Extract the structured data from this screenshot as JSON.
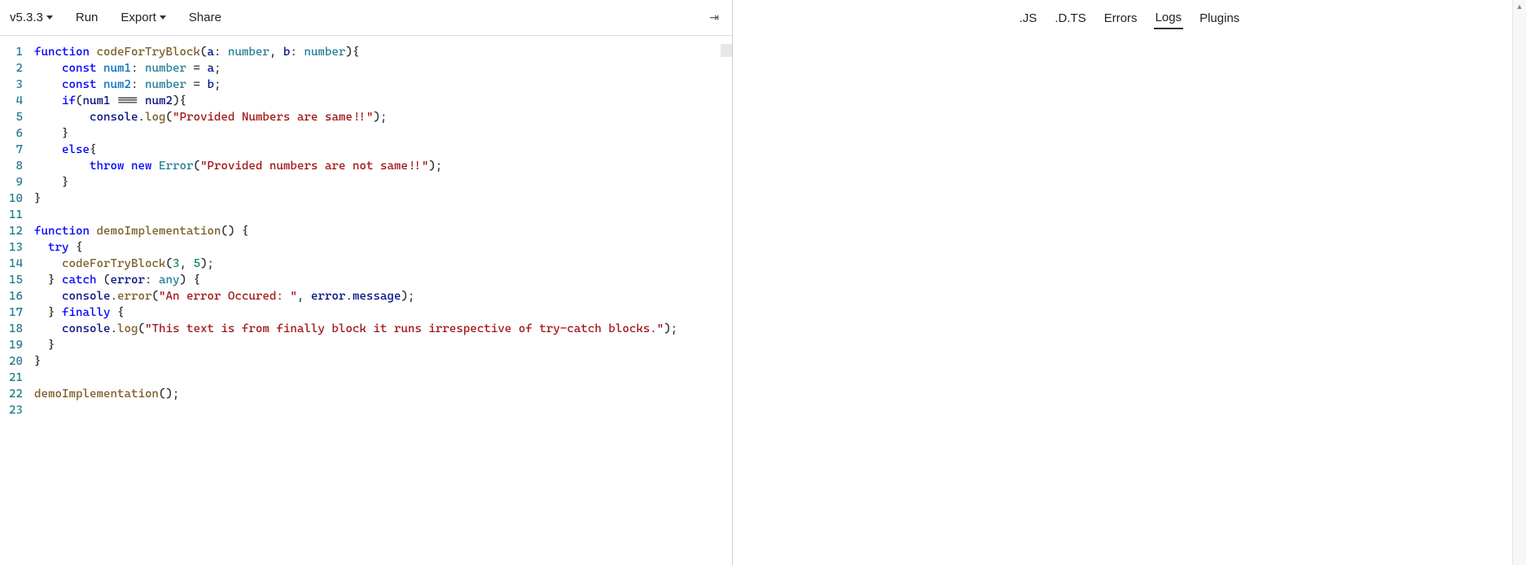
{
  "toolbar": {
    "version": "v5.3.3",
    "run": "Run",
    "export": "Export",
    "share": "Share"
  },
  "right_tabs": {
    "js": ".JS",
    "dts": ".D.TS",
    "errors": "Errors",
    "logs": "Logs",
    "plugins": "Plugins",
    "active": "logs"
  },
  "editor": {
    "line_count": 23,
    "code_lines": [
      [
        {
          "t": "kw",
          "v": "function"
        },
        {
          "t": "punc",
          "v": " "
        },
        {
          "t": "fn",
          "v": "codeForTryBlock"
        },
        {
          "t": "punc",
          "v": "("
        },
        {
          "t": "var",
          "v": "a"
        },
        {
          "t": "punc",
          "v": ": "
        },
        {
          "t": "type",
          "v": "number"
        },
        {
          "t": "punc",
          "v": ", "
        },
        {
          "t": "var",
          "v": "b"
        },
        {
          "t": "punc",
          "v": ": "
        },
        {
          "t": "type",
          "v": "number"
        },
        {
          "t": "punc",
          "v": "){"
        }
      ],
      [
        {
          "t": "punc",
          "v": "    "
        },
        {
          "t": "kw",
          "v": "const"
        },
        {
          "t": "punc",
          "v": " "
        },
        {
          "t": "const",
          "v": "num1"
        },
        {
          "t": "punc",
          "v": ": "
        },
        {
          "t": "type",
          "v": "number"
        },
        {
          "t": "punc",
          "v": " = "
        },
        {
          "t": "var",
          "v": "a"
        },
        {
          "t": "punc",
          "v": ";"
        }
      ],
      [
        {
          "t": "punc",
          "v": "    "
        },
        {
          "t": "kw",
          "v": "const"
        },
        {
          "t": "punc",
          "v": " "
        },
        {
          "t": "const",
          "v": "num2"
        },
        {
          "t": "punc",
          "v": ": "
        },
        {
          "t": "type",
          "v": "number"
        },
        {
          "t": "punc",
          "v": " = "
        },
        {
          "t": "var",
          "v": "b"
        },
        {
          "t": "punc",
          "v": ";"
        }
      ],
      [
        {
          "t": "punc",
          "v": "    "
        },
        {
          "t": "kw",
          "v": "if"
        },
        {
          "t": "punc",
          "v": "("
        },
        {
          "t": "var",
          "v": "num1"
        },
        {
          "t": "punc",
          "v": " === "
        },
        {
          "t": "var",
          "v": "num2"
        },
        {
          "t": "punc",
          "v": "){"
        }
      ],
      [
        {
          "t": "punc",
          "v": "        "
        },
        {
          "t": "var",
          "v": "console"
        },
        {
          "t": "punc",
          "v": "."
        },
        {
          "t": "fn",
          "v": "log"
        },
        {
          "t": "punc",
          "v": "("
        },
        {
          "t": "str",
          "v": "\"Provided Numbers are same!!\""
        },
        {
          "t": "punc",
          "v": ");"
        }
      ],
      [
        {
          "t": "punc",
          "v": "    }"
        }
      ],
      [
        {
          "t": "punc",
          "v": "    "
        },
        {
          "t": "kw",
          "v": "else"
        },
        {
          "t": "punc",
          "v": "{"
        }
      ],
      [
        {
          "t": "punc",
          "v": "        "
        },
        {
          "t": "kw",
          "v": "throw"
        },
        {
          "t": "punc",
          "v": " "
        },
        {
          "t": "kw",
          "v": "new"
        },
        {
          "t": "punc",
          "v": " "
        },
        {
          "t": "err",
          "v": "Error"
        },
        {
          "t": "punc",
          "v": "("
        },
        {
          "t": "str",
          "v": "\"Provided numbers are not same!!\""
        },
        {
          "t": "punc",
          "v": ");"
        }
      ],
      [
        {
          "t": "punc",
          "v": "    }"
        }
      ],
      [
        {
          "t": "punc",
          "v": "}"
        }
      ],
      [],
      [
        {
          "t": "kw",
          "v": "function"
        },
        {
          "t": "punc",
          "v": " "
        },
        {
          "t": "fn",
          "v": "demoImplementation"
        },
        {
          "t": "punc",
          "v": "() {"
        }
      ],
      [
        {
          "t": "punc",
          "v": "  "
        },
        {
          "t": "kw",
          "v": "try"
        },
        {
          "t": "punc",
          "v": " {"
        }
      ],
      [
        {
          "t": "punc",
          "v": "    "
        },
        {
          "t": "fn",
          "v": "codeForTryBlock"
        },
        {
          "t": "punc",
          "v": "("
        },
        {
          "t": "num",
          "v": "3"
        },
        {
          "t": "punc",
          "v": ", "
        },
        {
          "t": "num",
          "v": "5"
        },
        {
          "t": "punc",
          "v": ");"
        }
      ],
      [
        {
          "t": "punc",
          "v": "  } "
        },
        {
          "t": "kw",
          "v": "catch"
        },
        {
          "t": "punc",
          "v": " ("
        },
        {
          "t": "var",
          "v": "error"
        },
        {
          "t": "punc",
          "v": ": "
        },
        {
          "t": "type",
          "v": "any"
        },
        {
          "t": "punc",
          "v": ") {"
        }
      ],
      [
        {
          "t": "punc",
          "v": "    "
        },
        {
          "t": "var",
          "v": "console"
        },
        {
          "t": "punc",
          "v": "."
        },
        {
          "t": "fn",
          "v": "error"
        },
        {
          "t": "punc",
          "v": "("
        },
        {
          "t": "str",
          "v": "\"An error Occured: \""
        },
        {
          "t": "punc",
          "v": ", "
        },
        {
          "t": "var",
          "v": "error"
        },
        {
          "t": "punc",
          "v": "."
        },
        {
          "t": "prop",
          "v": "message"
        },
        {
          "t": "punc",
          "v": ");"
        }
      ],
      [
        {
          "t": "punc",
          "v": "  } "
        },
        {
          "t": "kw",
          "v": "finally"
        },
        {
          "t": "punc",
          "v": " {"
        }
      ],
      [
        {
          "t": "punc",
          "v": "    "
        },
        {
          "t": "var",
          "v": "console"
        },
        {
          "t": "punc",
          "v": "."
        },
        {
          "t": "fn",
          "v": "log"
        },
        {
          "t": "punc",
          "v": "("
        },
        {
          "t": "str",
          "v": "\"This text is from finally block it runs irrespective of try-catch blocks.\""
        },
        {
          "t": "punc",
          "v": ");"
        }
      ],
      [
        {
          "t": "punc",
          "v": "  }"
        }
      ],
      [
        {
          "t": "punc",
          "v": "}"
        }
      ],
      [],
      [
        {
          "t": "fn",
          "v": "demoImplementation"
        },
        {
          "t": "punc",
          "v": "();"
        }
      ],
      []
    ]
  }
}
